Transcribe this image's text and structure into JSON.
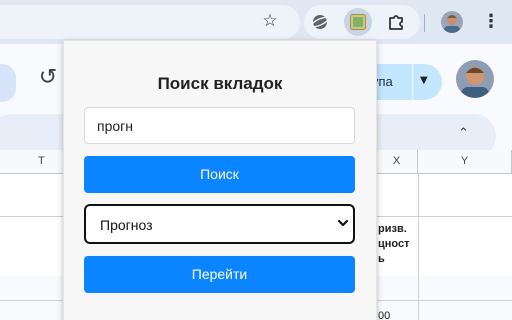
{
  "browser": {
    "icons": {
      "bookmark": "star-icon",
      "extension_1": "extension-icon",
      "extension_2": "tab-search-extension-icon",
      "extensions_menu": "puzzle-icon",
      "menu": "kebab-menu-icon"
    }
  },
  "sheet_page": {
    "share_label": "упа",
    "column_headers": [
      "T",
      "X",
      "Y"
    ],
    "cell_lines": [
      "ризв.",
      "цност",
      "ь"
    ],
    "bottom_cell": "00",
    "colors": {
      "share_button": "#c2e7ff",
      "accent": "#0a84ff"
    }
  },
  "popup": {
    "title": "Поиск вкладок",
    "search_input_value": "прогн",
    "search_button_label": "Поиск",
    "selected_option": "Прогноз",
    "go_button_label": "Перейти"
  }
}
